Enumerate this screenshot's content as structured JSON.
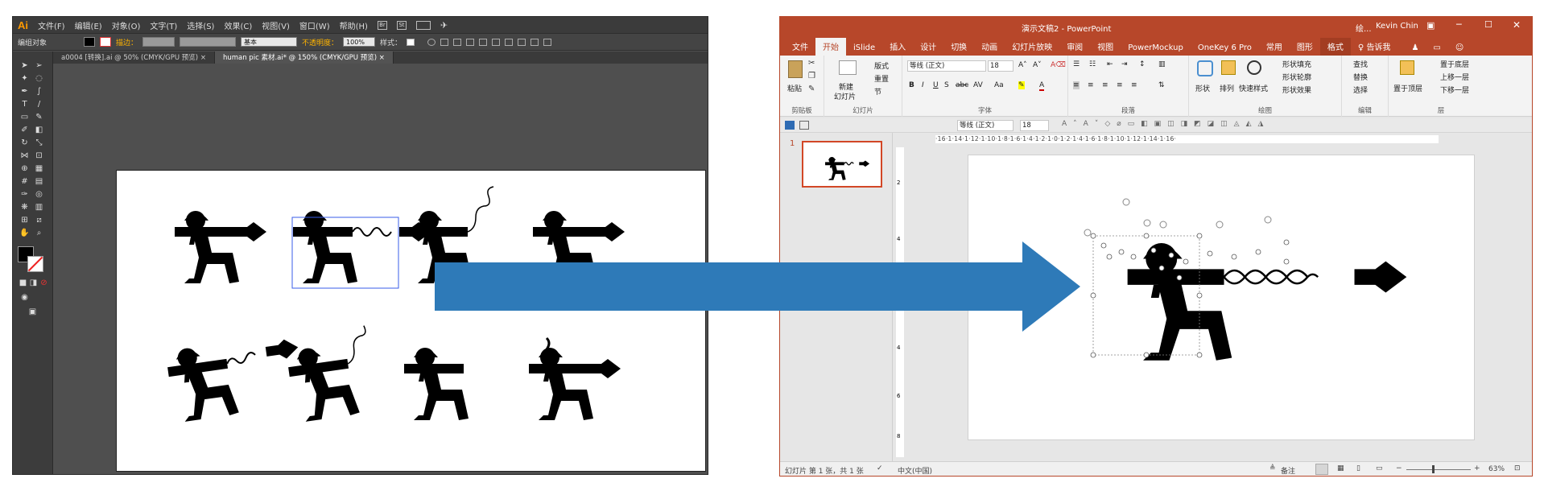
{
  "illustrator": {
    "logo": "Ai",
    "menu": [
      "文件(F)",
      "编辑(E)",
      "对象(O)",
      "文字(T)",
      "选择(S)",
      "效果(C)",
      "视图(V)",
      "窗口(W)",
      "帮助(H)"
    ],
    "control_bar": {
      "selection": "编组对象",
      "stroke_label": "描边：",
      "stroke_style": "基本",
      "opacity_label": "不透明度：",
      "opacity_value": "100%",
      "style_label": "样式："
    },
    "tabs": [
      {
        "label": "a0004 [转换].ai @ 50% (CMYK/GPU 预览)"
      },
      {
        "label": "human pic 素材.ai* @ 150% (CMYK/GPU 预览)"
      }
    ]
  },
  "powerpoint": {
    "title": "演示文稿2 - PowerPoint",
    "title_extra": "绘...",
    "user": "Kevin Chin",
    "tabs": [
      "文件",
      "开始",
      "iSlide",
      "插入",
      "设计",
      "切换",
      "动画",
      "幻灯片放映",
      "审阅",
      "视图",
      "PowerMockup",
      "OneKey 6 Pro",
      "常用",
      "图形",
      "格式"
    ],
    "active_tab": "开始",
    "tell_me": "告诉我",
    "ribbon": {
      "clipboard": {
        "paste": "粘贴",
        "label": "剪贴板"
      },
      "slides": {
        "new_slide_1": "新建",
        "new_slide_2": "幻灯片",
        "layout": "版式",
        "reset": "重置",
        "section": "节",
        "label": "幻灯片"
      },
      "font": {
        "name": "等线 (正文)",
        "size": "18",
        "label": "字体",
        "bold": "B",
        "italic": "I",
        "underline": "U",
        "shadow": "S",
        "strike": "abc",
        "spacing": "AV",
        "case": "Aa"
      },
      "paragraph": {
        "label": "段落"
      },
      "drawing": {
        "shape": "形状",
        "arrange": "排列",
        "quick_styles": "快速样式",
        "fill": "形状填充",
        "outline": "形状轮廓",
        "effects": "形状效果",
        "label": "绘图"
      },
      "editing": {
        "find": "查找",
        "replace": "替换",
        "select": "选择",
        "label": "编辑"
      },
      "layers": {
        "top": "置于顶层",
        "bottom": "置于底层",
        "up": "上移一层",
        "down": "下移一层",
        "label": "层"
      }
    },
    "qat": {
      "font": "等线 (正文)",
      "size": "18"
    },
    "ruler_h": "·16·1·14·1·12·1·10·1·8·1·6·1·4·1·2·1·0·1·2·1·4·1·6·1·8·1·10·1·12·1·14·1·16·",
    "ruler_v": [
      "2",
      "4",
      "2",
      "4",
      "6",
      "8"
    ],
    "slide_number": "1",
    "status": {
      "slide": "幻灯片 第 1 张，共 1 张",
      "lang": "中文(中国)",
      "notes": "备注",
      "zoom": "63%"
    }
  },
  "colors": {
    "ppt_accent": "#b7472a",
    "arrow": "#2e7ab8",
    "ai_bg": "#4f4f4f",
    "selection": "#3a5ee8"
  }
}
